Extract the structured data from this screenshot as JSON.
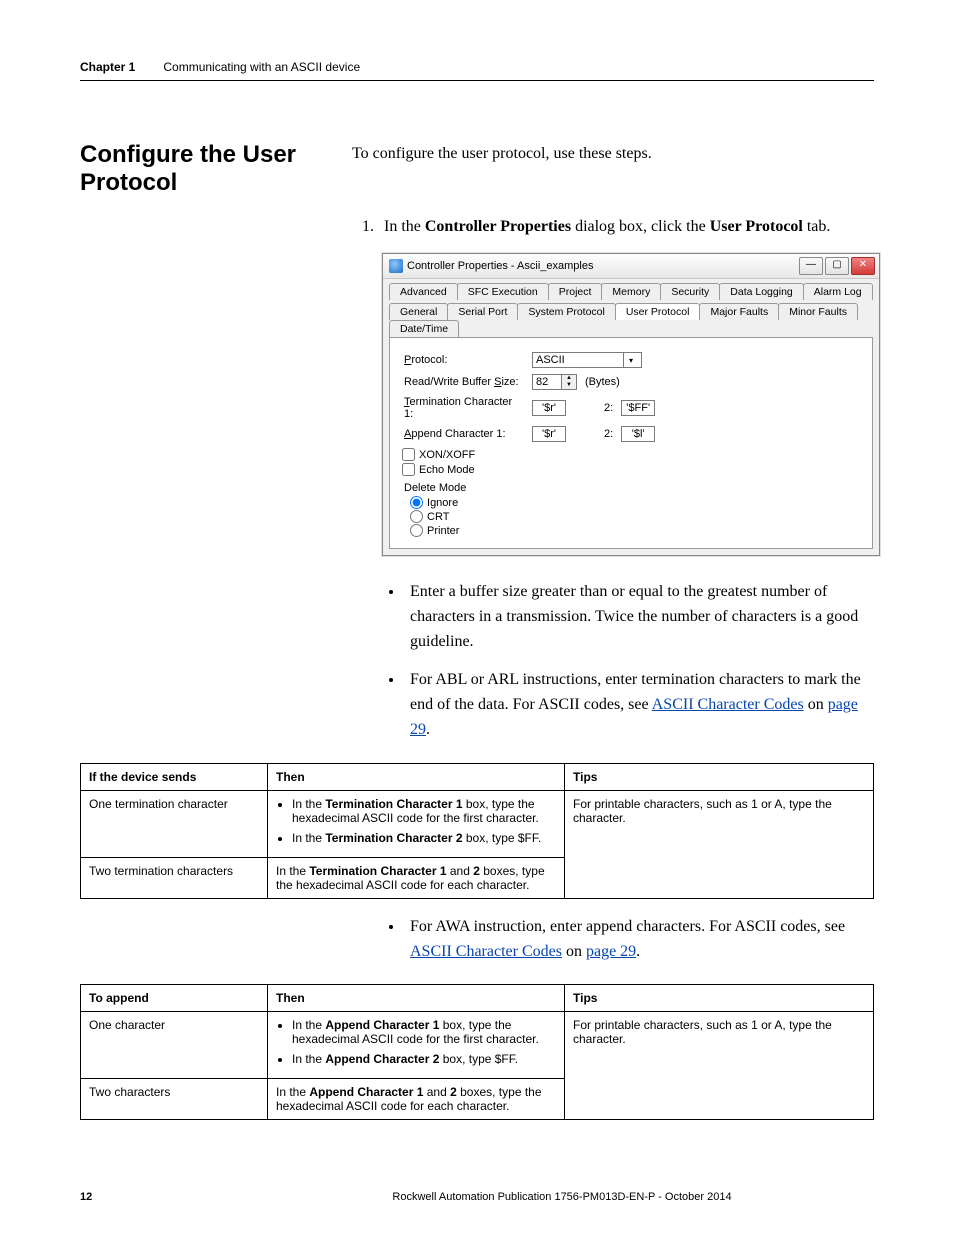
{
  "header": {
    "chapter": "Chapter 1",
    "title": "Communicating with an ASCII device"
  },
  "section": {
    "heading": "Configure the User Protocol",
    "intro": "To configure the user protocol, use these steps.",
    "step1_pre": "In the ",
    "step1_b1": "Controller Properties",
    "step1_mid": " dialog box, click the ",
    "step1_b2": "User Protocol",
    "step1_post": " tab."
  },
  "dialog": {
    "title": "Controller Properties - Ascii_examples",
    "tabs_row1": [
      "Advanced",
      "SFC Execution",
      "Project",
      "Memory",
      "Security",
      "Data Logging",
      "Alarm Log"
    ],
    "tabs_row2": [
      "General",
      "Serial Port",
      "System Protocol",
      "User Protocol",
      "Major Faults",
      "Minor Faults",
      "Date/Time"
    ],
    "active_tab": "User Protocol",
    "labels": {
      "protocol": "Protocol:",
      "protocol_value": "ASCII",
      "buffer": "Read/Write Buffer Size:",
      "buffer_value": "82",
      "buffer_unit": "(Bytes)",
      "term1": "Termination Character 1:",
      "term1_value": "'$r'",
      "two": "2:",
      "term2_value": "'$FF'",
      "append1": "Append Character 1:",
      "append1_value": "'$r'",
      "append2_value": "'$l'",
      "xon": "XON/XOFF",
      "echo": "Echo Mode",
      "delete": "Delete Mode",
      "ignore": "Ignore",
      "crt": "CRT",
      "printer": "Printer"
    }
  },
  "bullets1": {
    "b1": "Enter a buffer size greater than or equal to the greatest number of characters in a transmission. Twice the number of characters is a good guideline.",
    "b2_pre": "For ABL or ARL instructions, enter termination characters to mark the end of the data. For ASCII codes, see ",
    "b2_link1": "ASCII Character Codes",
    "b2_mid": " on ",
    "b2_link2": "page 29",
    "b2_post": "."
  },
  "table1": {
    "h1": "If the device sends",
    "h2": "Then",
    "h3": "Tips",
    "r1c1": "One termination character",
    "r1c2a_pre": "In the ",
    "r1c2a_b": "Termination Character 1",
    "r1c2a_post": " box, type the hexadecimal ASCII code for the first character.",
    "r1c2b_pre": "In the ",
    "r1c2b_b": "Termination Character 2",
    "r1c2b_post": " box, type $FF.",
    "r1c3": "For printable characters, such as 1 or A, type the character.",
    "r2c1": "Two termination characters",
    "r2c2_pre": "In the ",
    "r2c2_b1": "Termination Character 1",
    "r2c2_mid": " and ",
    "r2c2_b2": "2",
    "r2c2_post": " boxes, type the hexadecimal ASCII code for each character."
  },
  "bullets2": {
    "b1_pre": "For AWA instruction, enter append characters. For ASCII codes, see ",
    "b1_link1": "ASCII Character Codes",
    "b1_mid": " on ",
    "b1_link2": "page 29",
    "b1_post": "."
  },
  "table2": {
    "h1": "To append",
    "h2": "Then",
    "h3": "Tips",
    "r1c1": "One character",
    "r1c2a_pre": "In the ",
    "r1c2a_b": "Append Character 1",
    "r1c2a_post": " box, type the hexadecimal ASCII code for the first character.",
    "r1c2b_pre": "In the ",
    "r1c2b_b": "Append Character 2",
    "r1c2b_post": " box, type $FF.",
    "r1c3": "For printable characters, such as 1 or A, type the character.",
    "r2c1": "Two characters",
    "r2c2_pre": "In the ",
    "r2c2_b1": "Append Character 1",
    "r2c2_mid": " and ",
    "r2c2_b2": "2",
    "r2c2_post": " boxes, type the hexadecimal ASCII code for each character."
  },
  "footer": {
    "page": "12",
    "pub": "Rockwell Automation Publication 1756-PM013D-EN-P - October 2014"
  }
}
